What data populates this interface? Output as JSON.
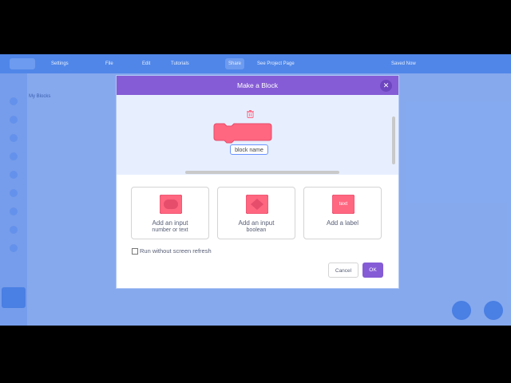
{
  "menubar": {
    "items": [
      "Settings",
      "File",
      "Edit",
      "Tutorials",
      "Share",
      "See Project Page",
      "Saved Now"
    ]
  },
  "background": {
    "my_blocks_label": "My Blocks"
  },
  "modal": {
    "title": "Make a Block",
    "close_icon": "x-icon",
    "preview": {
      "block_name_value": "block name",
      "trash_icon": "trash-icon",
      "block_color": "#ff6680"
    },
    "options": [
      {
        "title": "Add an input",
        "subtitle": "number or text",
        "icon": "round-input-icon"
      },
      {
        "title": "Add an input",
        "subtitle": "boolean",
        "icon": "hexagon-input-icon"
      },
      {
        "title": "Add a label",
        "subtitle": "",
        "icon": "label-icon",
        "icon_text": "text"
      }
    ],
    "checkbox_label": "Run without screen refresh",
    "cancel_label": "Cancel",
    "ok_label": "OK"
  },
  "colors": {
    "header": "#855cd6",
    "block": "#ff6680",
    "menubar": "#4f86e8"
  }
}
